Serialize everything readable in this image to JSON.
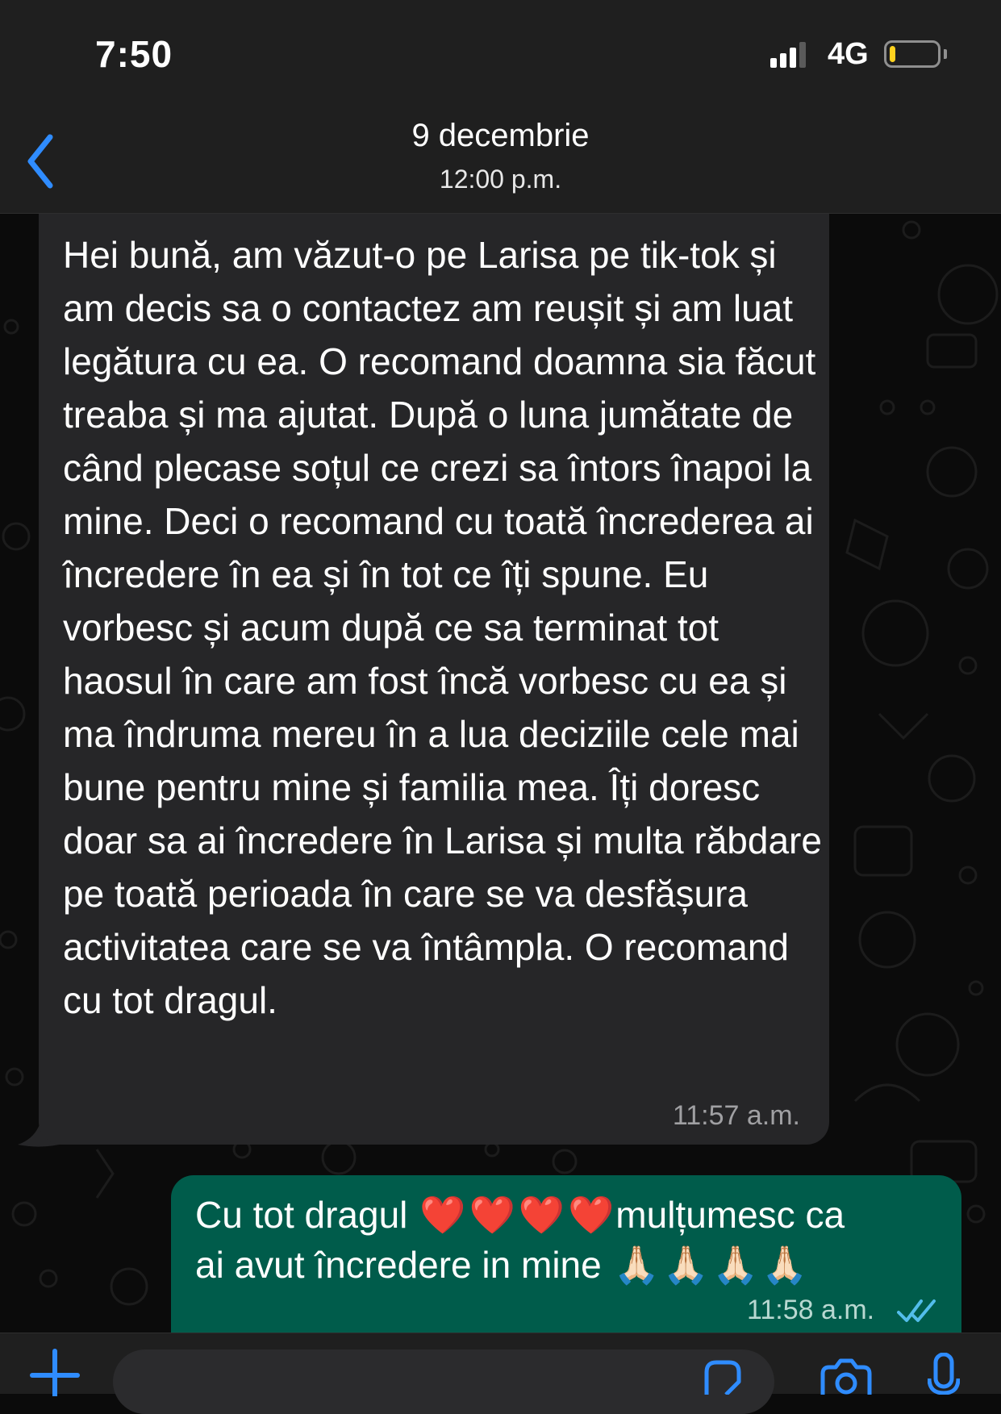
{
  "status_bar": {
    "time": "7:50",
    "network": "4G",
    "signal_bars": 3,
    "battery_level": 0.12,
    "battery_color": "#ffd21f"
  },
  "header": {
    "back_icon": "chevron-left-icon",
    "date": "9 decembrie",
    "time": "12:00 p.m.",
    "accent_color": "#2f8cff"
  },
  "messages": [
    {
      "direction": "incoming",
      "text": "Hei bună, am văzut-o pe Larisa pe tik-tok și am decis sa o contactez am reușit și am luat legătura cu ea. O recomand doamna sia făcut treaba și ma ajutat. După o luna jumătate de când plecase soțul ce crezi sa întors înapoi la mine. Deci o recomand cu toată încrederea ai încredere în ea și în tot ce îți spune. Eu vorbesc și acum după ce sa terminat tot haosul în care am fost încă vorbesc cu ea și ma îndruma mereu în a lua deciziile cele mai bune pentru mine și familia mea. Îți doresc doar sa ai încredere în Larisa și multa răbdare pe toată perioada în care se va desfășura activitatea care se va întâmpla. O recomand cu tot dragul.",
      "time": "11:57 a.m.",
      "bubble_color": "#262628"
    },
    {
      "direction": "outgoing",
      "text_part1": "Cu tot dragul",
      "text_part2": "mulțumesc ca",
      "text_part3": "ai avut încredere in mine",
      "heart_emoji": "❤️",
      "pray_emoji": "🙏🏻",
      "time": "11:58 a.m.",
      "status_icon": "double-check-read-icon",
      "bubble_color": "#005c4b"
    }
  ],
  "input_bar": {
    "plus_icon": "plus-icon",
    "placeholder": "",
    "sticker_icon": "sticker-icon",
    "camera_icon": "camera-icon",
    "mic_icon": "microphone-icon"
  }
}
